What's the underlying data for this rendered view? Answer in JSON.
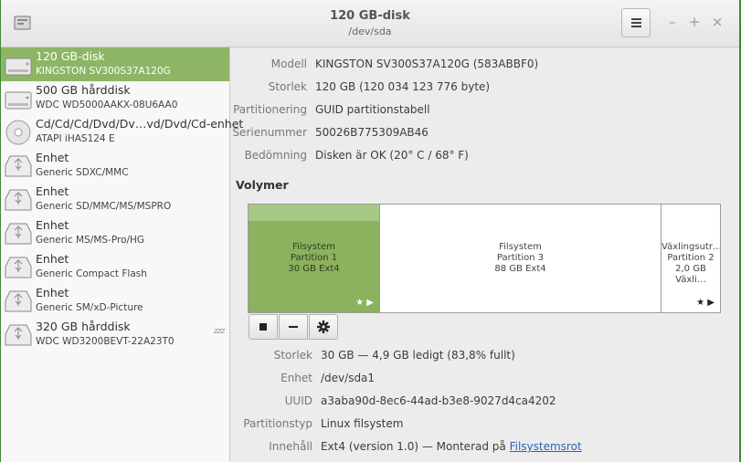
{
  "window": {
    "title": "120 GB-disk",
    "subtitle": "/dev/sda",
    "buttons": {
      "minimize": "–",
      "maximize": "+",
      "close": "×"
    }
  },
  "sidebar": {
    "items": [
      {
        "name": "120 GB-disk",
        "detail": "KINGSTON SV300S37A120G",
        "icon": "drive-icon",
        "selected": true
      },
      {
        "name": "500 GB hårddisk",
        "detail": "WDC WD5000AAKX-08U6AA0",
        "icon": "drive-icon"
      },
      {
        "name": "Cd/Cd/Cd/Dvd/Dv…vd/Dvd/Cd-enhet",
        "detail": "ATAPI   iHAS124   E",
        "icon": "optical-disc-icon"
      },
      {
        "name": "Enhet",
        "detail": "Generic SDXC/MMC",
        "icon": "usb-drive-icon"
      },
      {
        "name": "Enhet",
        "detail": "Generic SD/MMC/MS/MSPRO",
        "icon": "usb-drive-icon"
      },
      {
        "name": "Enhet",
        "detail": "Generic MS/MS-Pro/HG",
        "icon": "usb-drive-icon"
      },
      {
        "name": "Enhet",
        "detail": "Generic Compact Flash",
        "icon": "usb-drive-icon"
      },
      {
        "name": "Enhet",
        "detail": "Generic SM/xD-Picture",
        "icon": "usb-drive-icon"
      },
      {
        "name": "320 GB hårddisk",
        "detail": "WDC WD3200BEVT-22A23T0",
        "icon": "usb-drive-icon",
        "badge": "zzz"
      }
    ]
  },
  "disk": {
    "model_label": "Modell",
    "model": "KINGSTON SV300S37A120G (583ABBF0)",
    "size_label": "Storlek",
    "size": "120 GB (120 034 123 776 byte)",
    "partitioning_label": "Partitionering",
    "partitioning": "GUID partitionstabell",
    "serial_label": "Serienummer",
    "serial": "50026B775309AB46",
    "assessment_label": "Bedömning",
    "assessment": "Disken är OK (20° C / 68° F)"
  },
  "volumes": {
    "heading": "Volymer",
    "segments": [
      {
        "line1": "Filsystem",
        "line2": "Partition 1",
        "line3": "30 GB Ext4",
        "marks": "★ ▶",
        "selected": true
      },
      {
        "line1": "Filsystem",
        "line2": "Partition 3",
        "line3": "88 GB Ext4",
        "marks": ""
      },
      {
        "line1": "Växlingsutr…",
        "line2": "Partition 2",
        "line3": "2,0 GB Växli…",
        "marks": "★ ▶"
      }
    ],
    "toolbar": {
      "stop_icon": "stop-icon",
      "minus_icon": "minus-icon",
      "gear_icon": "gear-icon"
    }
  },
  "partition": {
    "size_label": "Storlek",
    "size": "30 GB — 4,9 GB ledigt (83,8% fullt)",
    "device_label": "Enhet",
    "device": "/dev/sda1",
    "uuid_label": "UUID",
    "uuid": "a3aba90d-8ec6-44ad-b3e8-9027d4ca4202",
    "type_label": "Partitionstyp",
    "type": "Linux filsystem",
    "contents_label": "Innehåll",
    "contents": "Ext4 (version 1.0) — Monterad på",
    "mount_link": "Filsystemsrot"
  },
  "colors": {
    "selection": "#8eb565",
    "desktop": "#3f8a34",
    "link": "#2a63b8"
  }
}
